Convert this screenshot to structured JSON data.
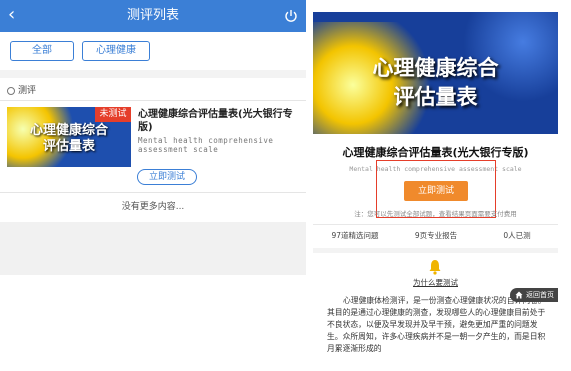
{
  "left": {
    "header_title": "测评列表",
    "back_icon": "chevron-left-icon",
    "power_icon": "power-icon",
    "filters": [
      "全部",
      "心理健康"
    ],
    "section_label": "测评",
    "item": {
      "badge": "未测试",
      "thumb_line1": "心理健康综合",
      "thumb_line2": "评估量表",
      "title": "心理健康综合评估量表(光大银行专版)",
      "desc": "Mental health comprehensive assessment scale",
      "start_label": "立即测试"
    },
    "no_more": "没有更多内容..."
  },
  "right": {
    "hero_line1": "心理健康综合",
    "hero_line2": "评估量表",
    "title": "心理健康综合评估量表(光大银行专版)",
    "subtitle": "Mental health comprehensive assessment scale",
    "start_label": "立即测试",
    "note": "注：您可以先测试全部试题，查看结果页面需要支付费用",
    "stats": [
      "97道精选问题",
      "9页专业报告",
      "0人已测"
    ],
    "why_label": "为什么要测试",
    "home_label": "返回首页",
    "body": "心理健康体检测评，是一份测查心理健康状况的自评问卷。其目的是通过心理健康的测查，发现哪些人的心理健康目前处于不良状态，以便及早发现并及早干预，避免更加严重的问题发生。众所周知，许多心理疾病并不是一朝一夕产生的，而是日积月累逐渐形成的"
  },
  "colors": {
    "primary": "#3b7fd6",
    "badge_red": "#e53e2a",
    "orange_button": "#f08a2c"
  }
}
